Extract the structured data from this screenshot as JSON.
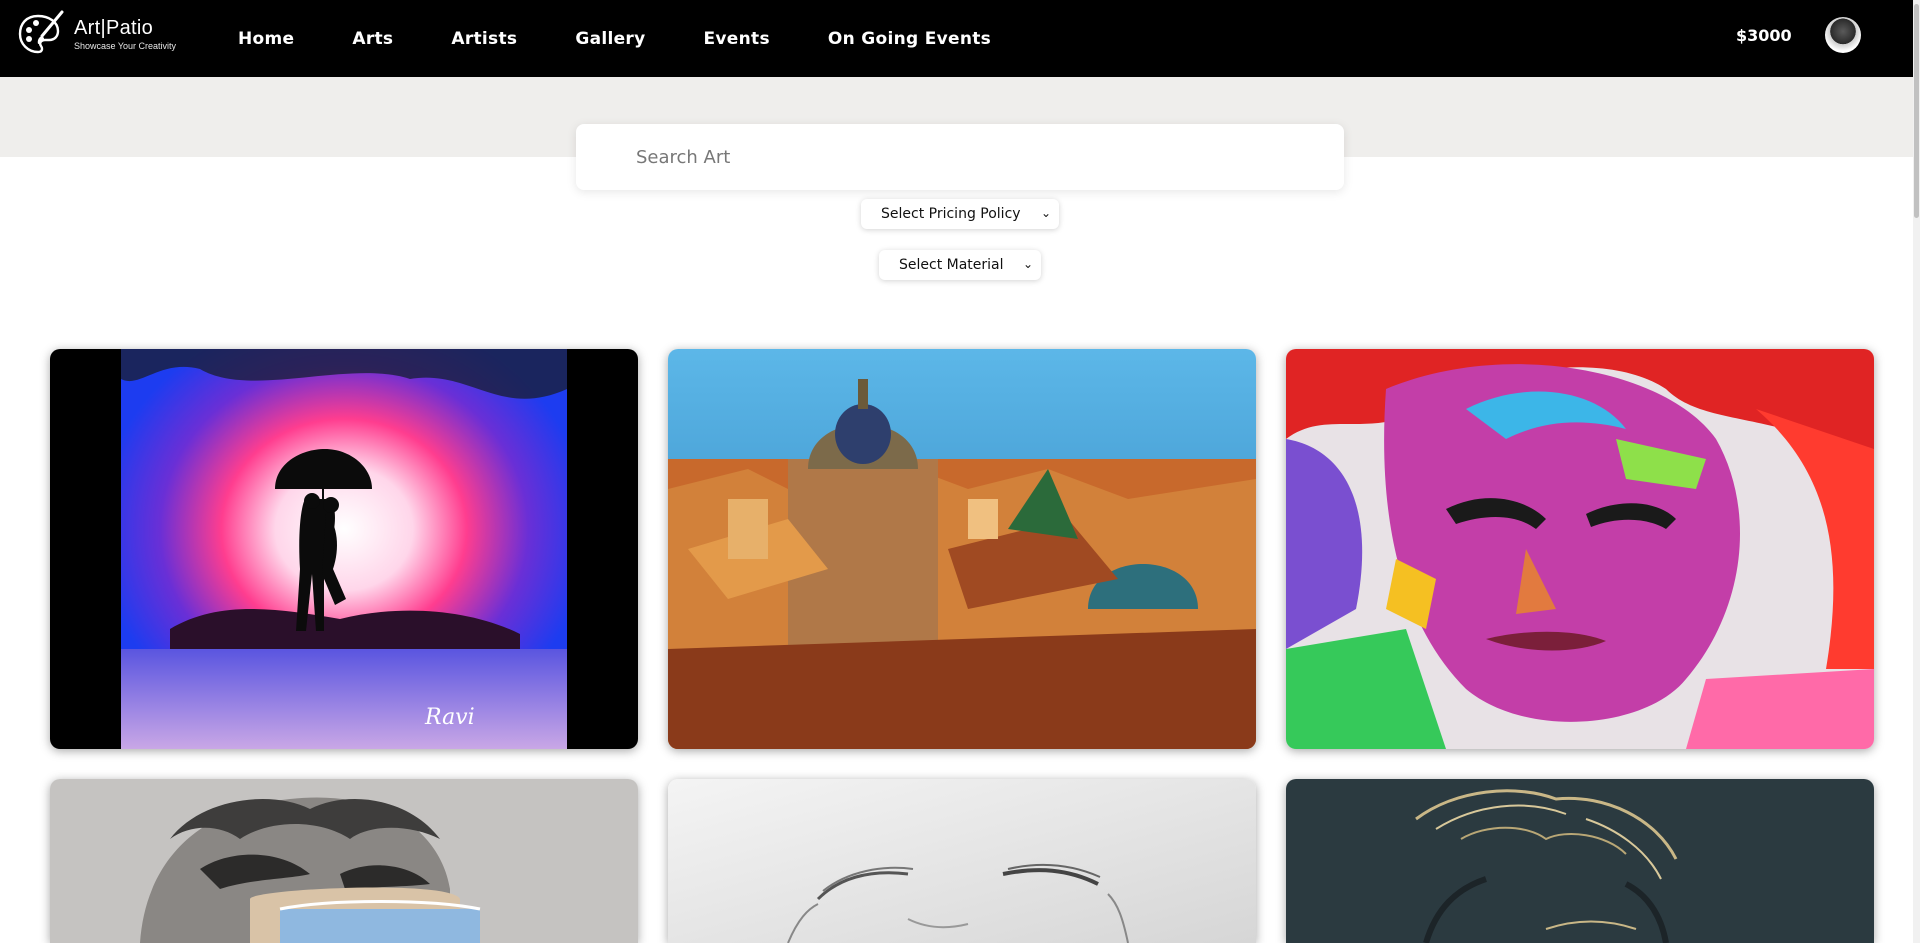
{
  "brand": {
    "name": "Art|Patio",
    "tagline": "Showcase Your Creativity",
    "logo_icon": "palette-brush-icon"
  },
  "nav": {
    "links": [
      "Home",
      "Arts",
      "Artists",
      "Gallery",
      "Events",
      "On Going Events"
    ]
  },
  "account": {
    "balance": "$3000",
    "avatar_icon": "user-avatar"
  },
  "search": {
    "placeholder": "Search Art",
    "value": ""
  },
  "filters": {
    "pricing": {
      "selected": "Select Pricing Policy"
    },
    "material": {
      "selected": "Select Material"
    }
  },
  "artworks": [
    {
      "name": "couple-under-umbrella-painting",
      "signature": "Ravi"
    },
    {
      "name": "colorful-city-domes-painting"
    },
    {
      "name": "abstract-colorful-face-painting"
    },
    {
      "name": "statue-with-mask-illustration"
    },
    {
      "name": "pencil-sketch-portrait"
    },
    {
      "name": "line-art-portrait-on-dark"
    }
  ],
  "colors": {
    "nav_bg": "#000000",
    "search_band": "#efeeec",
    "text_light": "#ffffff"
  }
}
